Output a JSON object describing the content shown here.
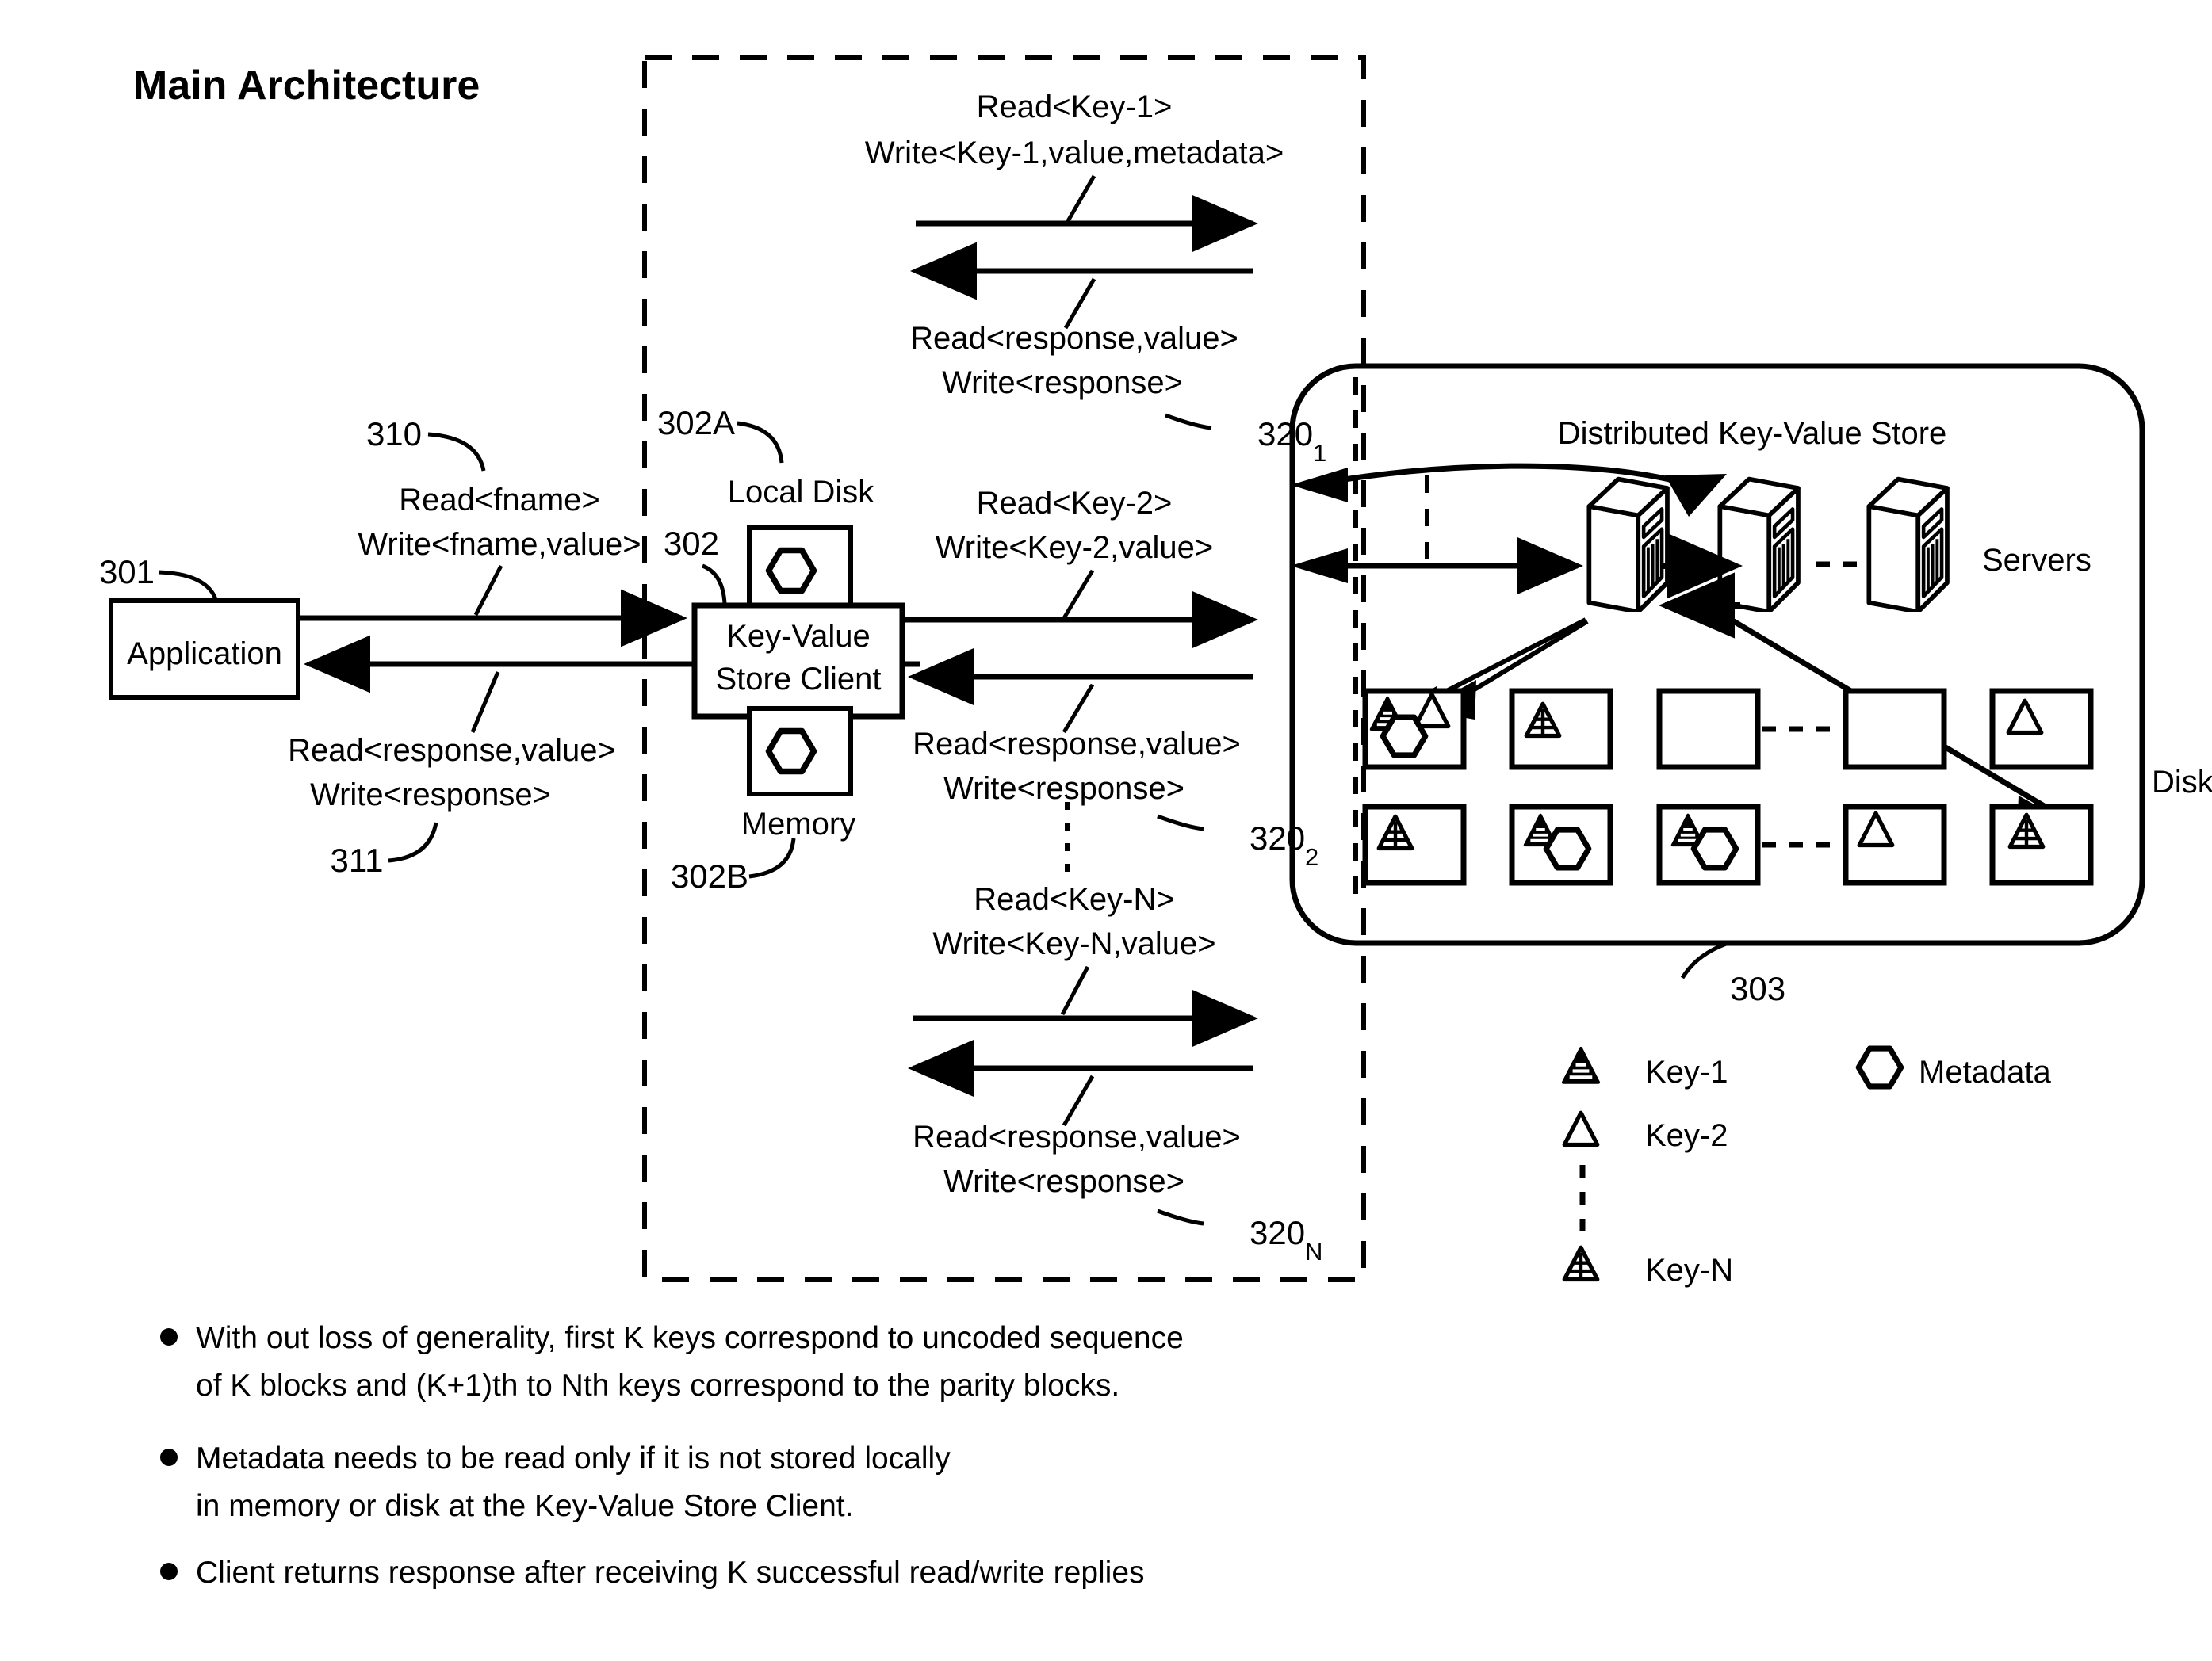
{
  "title": "Main Architecture",
  "blocks": {
    "application": {
      "label": "Application",
      "ref": "301"
    },
    "kv_client": {
      "label_line1": "Key-Value",
      "label_line2": "Store Client",
      "ref": "302"
    },
    "local_disk": {
      "label": "Local Disk",
      "ref": "302A"
    },
    "memory": {
      "label": "Memory",
      "ref": "302B"
    },
    "distributed_store": {
      "label": "Distributed Key-Value Store",
      "ref": "303"
    },
    "servers": {
      "label": "Servers"
    },
    "disks": {
      "label": "Disks"
    }
  },
  "flows": {
    "app_client": {
      "request_line1": "Read<fname>",
      "request_line2": "Write<fname,value>",
      "request_ref": "310",
      "response_line1": "Read<response,value>",
      "response_line2": "Write<response>",
      "response_ref": "311"
    },
    "key1": {
      "request_line1": "Read<Key-1>",
      "request_line2": "Write<Key-1,value,metadata>",
      "response_line1": "Read<response,value>",
      "response_line2": "Write<response>",
      "ref_base": "320",
      "ref_sub": "1"
    },
    "key2": {
      "request_line1": "Read<Key-2>",
      "request_line2": "Write<Key-2,value>",
      "response_line1": "Read<response,value>",
      "response_line2": "Write<response>",
      "ref_base": "320",
      "ref_sub": "2"
    },
    "keyn": {
      "request_line1": "Read<Key-N>",
      "request_line2": "Write<Key-N,value>",
      "response_line1": "Read<response,value>",
      "response_line2": "Write<response>",
      "ref_base": "320",
      "ref_sub": "N"
    }
  },
  "legend": {
    "items": [
      {
        "icon": "triangle-striped-icon",
        "label": "Key-1"
      },
      {
        "icon": "triangle-outline-icon",
        "label": "Key-2"
      },
      {
        "icon": "triangle-grid-icon",
        "label": "Key-N"
      },
      {
        "icon": "hexagon-outline-icon",
        "label": "Metadata"
      }
    ]
  },
  "notes": [
    "With out loss of generality, first K keys correspond to uncoded sequence of K blocks and (K+1)th to Nth keys correspond to the parity blocks.",
    "Metadata needs to be read only if it is not stored locally in memory or disk at the Key-Value Store Client.",
    "Client returns response after receiving K successful read/write replies"
  ],
  "notes_lines": [
    [
      "With out loss of generality, first K keys correspond to uncoded sequence",
      "of K blocks and (K+1)th to Nth keys correspond to the parity blocks."
    ],
    [
      "Metadata needs to be read only if it is not stored locally",
      "in memory or disk at the Key-Value Store Client."
    ],
    [
      "Client returns response after receiving K successful read/write replies"
    ]
  ],
  "colors": {
    "ink": "#000000",
    "paper": "#ffffff"
  }
}
